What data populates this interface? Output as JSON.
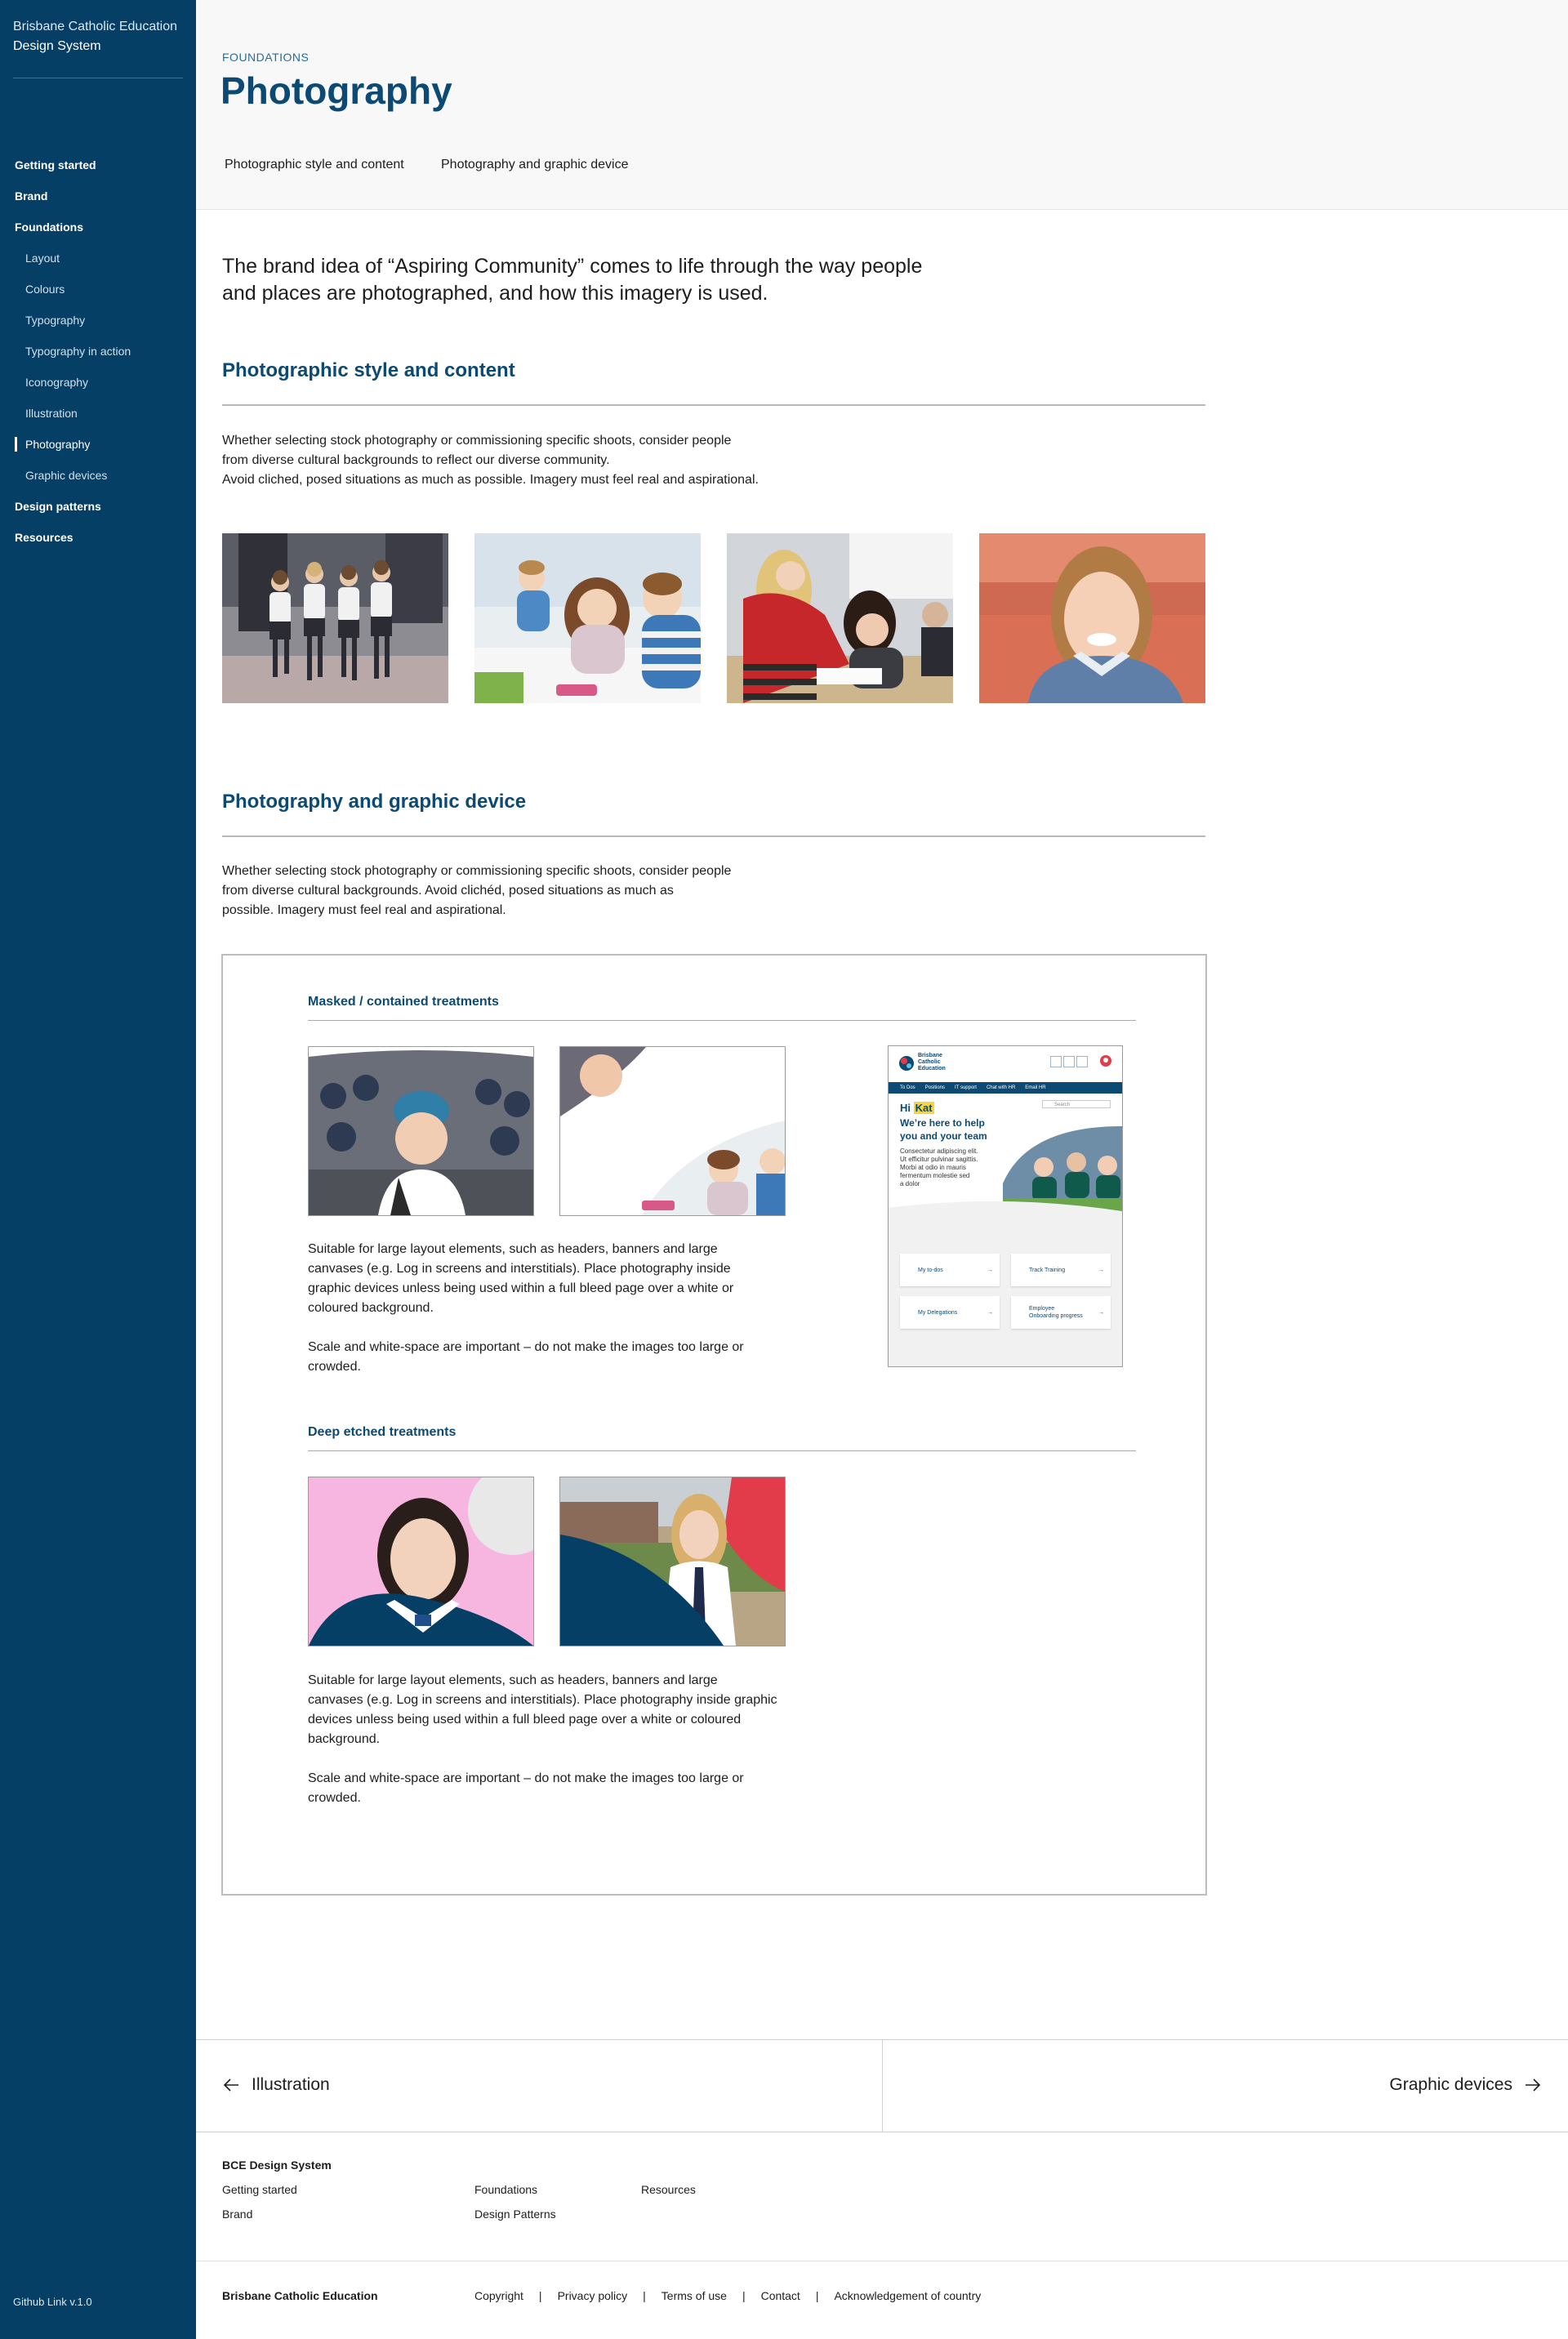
{
  "sidebar": {
    "brand_line1": "Brisbane Catholic Education",
    "brand_line2": "Design System",
    "items": [
      {
        "label": "Getting started"
      },
      {
        "label": "Brand"
      },
      {
        "label": "Foundations"
      },
      {
        "label": "Layout"
      },
      {
        "label": "Colours"
      },
      {
        "label": "Typography"
      },
      {
        "label": "Typography in action"
      },
      {
        "label": "Iconography"
      },
      {
        "label": "Illustration"
      },
      {
        "label": "Photography"
      },
      {
        "label": "Graphic devices"
      },
      {
        "label": "Design patterns"
      },
      {
        "label": "Resources"
      }
    ],
    "github": "Github Link v.1.0"
  },
  "header": {
    "eyebrow": "FOUNDATIONS",
    "title": "Photography",
    "tabs": [
      {
        "label": "Photographic style and content"
      },
      {
        "label": "Photography and graphic device"
      }
    ]
  },
  "main": {
    "intro_line1": "The brand idea of “Aspiring Community” comes to life through the way people",
    "intro_line2": "and places are photographed, and how this imagery is used.",
    "section1": {
      "title": "Photographic style and content",
      "lines": [
        "Whether selecting stock photography or commissioning specific shoots, consider people",
        "from diverse cultural backgrounds to reflect our diverse community.",
        "Avoid cliched, posed situations as much as possible. Imagery must feel real and aspirational."
      ]
    },
    "section2": {
      "title": "Photography and graphic device",
      "lines": [
        "Whether selecting stock photography or commissioning specific shoots, consider people",
        "from diverse cultural backgrounds. Avoid clichéd, posed situations as much as",
        "possible. Imagery must feel real and aspirational."
      ]
    },
    "masked": {
      "title": "Masked / contained treatments",
      "lines": [
        "Suitable for large layout elements, such as headers, banners and large",
        "canvases (e.g. Log in screens and interstitials). Place photography inside",
        "graphic devices unless being used within a full bleed page over a white or",
        "coloured background."
      ],
      "note_lines": [
        "Scale and white-space are important – do not make the images too large or",
        "crowded."
      ]
    },
    "deep": {
      "title": "Deep etched treatments",
      "lines": [
        "Suitable for large layout elements, such as headers, banners and large",
        "canvases (e.g. Log in screens and interstitials). Place photography inside graphic",
        "devices unless being used within a full bleed page over a white or coloured",
        "background."
      ],
      "note_lines": [
        "Scale and white-space are important – do not make the images too large or",
        "crowded."
      ]
    },
    "mockup": {
      "logo_line1": "Brisbane",
      "logo_line2": "Catholic",
      "logo_line3": "Education",
      "nav": [
        "To Dos",
        "Positions",
        "IT support",
        "Chat with HR",
        "Email HR"
      ],
      "search": "Search",
      "hi": "Hi",
      "name": "Kat",
      "headline_line1": "We’re here to help",
      "headline_line2": "you and your team",
      "body_lines": [
        "Consectetur adipiscing elit.",
        "Ut efficitur pulvinar sagittis.",
        "Morbi at odio in mauris",
        "fermentum molestie sed",
        "a dolor"
      ],
      "cards": [
        {
          "label": "My to-dos"
        },
        {
          "label": "Track Training"
        },
        {
          "label": "My Delegations"
        },
        {
          "label_line1": "Employee",
          "label_line2": "Onboarding progress"
        }
      ]
    }
  },
  "pager": {
    "prev": "Illustration",
    "next": "Graphic devices"
  },
  "footer": {
    "title": "BCE Design System",
    "col1": [
      "Getting started",
      "Brand"
    ],
    "col2": [
      "Foundations",
      "Design Patterns"
    ],
    "col3": [
      "Resources"
    ],
    "brand": "Brisbane Catholic Education",
    "legal": [
      "Copyright",
      "Privacy policy",
      "Terms of use",
      "Contact",
      "Acknowledgement of country"
    ]
  },
  "colors": {
    "navy": "#063f66",
    "heading": "#0d4a73",
    "highlight": "#f6d63a",
    "pink": "#f6b6e0",
    "red": "#e23c4b"
  }
}
